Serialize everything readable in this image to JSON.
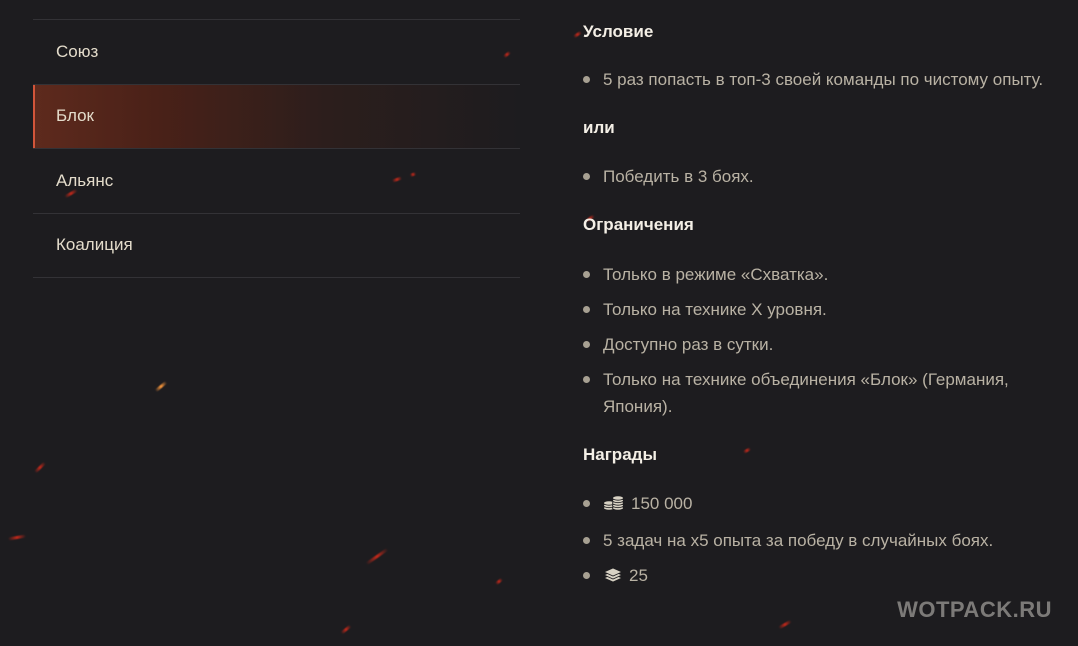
{
  "tabs": [
    {
      "label": "Союз"
    },
    {
      "label": "Блок"
    },
    {
      "label": "Альянс"
    },
    {
      "label": "Коалиция"
    }
  ],
  "active_tab": "Блок",
  "sections": {
    "condition": {
      "title": "Условие",
      "items": [
        "5 раз попасть в топ-3 своей команды по чистому опыту."
      ]
    },
    "or": {
      "title": "или",
      "items": [
        "Победить в 3 боях."
      ]
    },
    "restrictions": {
      "title": "Ограничения",
      "items": [
        "Только в режиме «Схватка».",
        "Только на технике X уровня.",
        "Доступно раз в сутки.",
        "Только на технике объединения «Блок» (Германия, Япония)."
      ]
    },
    "rewards": {
      "title": "Награды",
      "credits": "150 000",
      "credits_icon": "credits-coins-icon",
      "task": "5 задач на x5 опыта за победу в случайных боях.",
      "blueprints": "25",
      "blueprints_icon": "blueprints-stack-icon"
    }
  },
  "watermark": "WOTPACK.RU",
  "colors": {
    "accent": "#d2553a",
    "background": "#1d1c1f",
    "text": "#b9b2a4",
    "heading": "#f4efe6"
  }
}
